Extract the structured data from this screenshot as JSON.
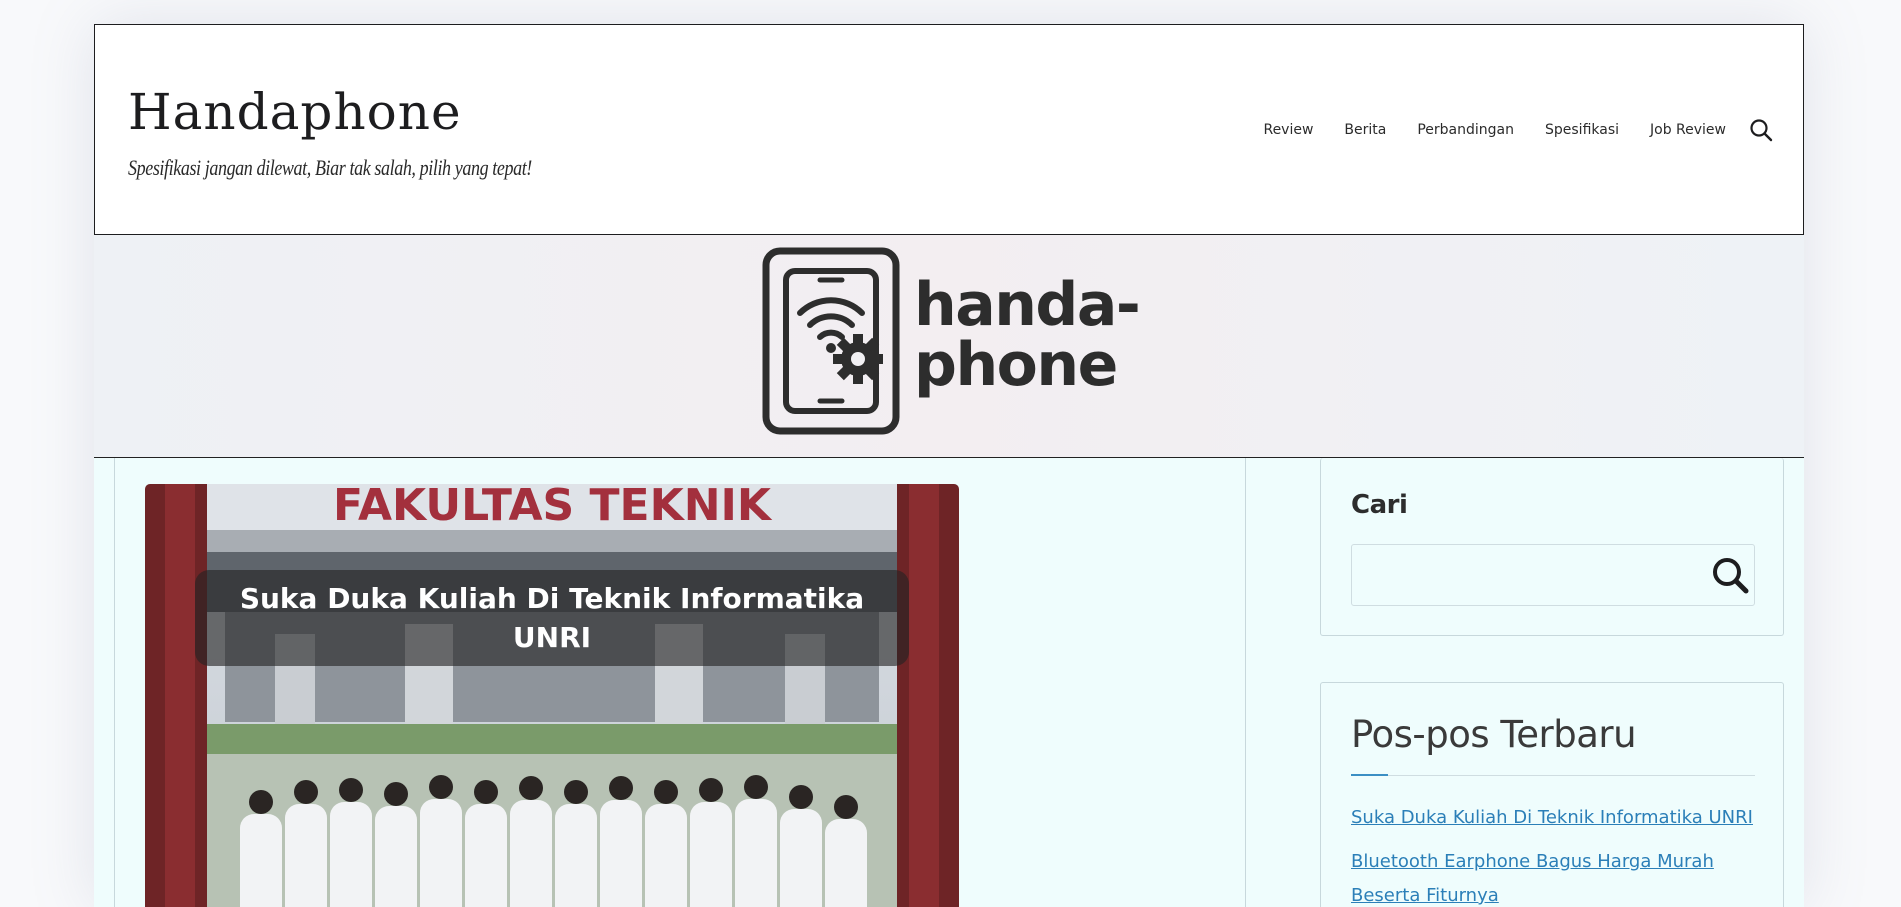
{
  "header": {
    "site_title": "Handaphone",
    "tagline": "Spesifikasi jangan dilewat, Biar tak salah, pilih yang tepat!",
    "nav": [
      {
        "label": "Review"
      },
      {
        "label": "Berita"
      },
      {
        "label": "Perbandingan"
      },
      {
        "label": "Spesifikasi"
      },
      {
        "label": "Job Review"
      }
    ],
    "search_icon": "search-icon"
  },
  "banner": {
    "logo_line1": "handa-",
    "logo_line2": "phone",
    "logo_icon": "smartphone-wifi-gear-icon"
  },
  "featured_post": {
    "image_sign_text": "FAKULTAS TEKNIK",
    "overlay_title": "Suka Duka Kuliah Di Teknik Informatika UNRI"
  },
  "sidebar": {
    "search": {
      "title": "Cari",
      "value": "",
      "button_icon": "search-icon"
    },
    "recent": {
      "title": "Pos-pos Terbaru",
      "items": [
        {
          "label": "Suka Duka Kuliah Di Teknik Informatika UNRI"
        },
        {
          "label": "Bluetooth Earphone Bagus Harga Murah Beserta Fiturnya"
        }
      ]
    }
  },
  "colors": {
    "link": "#2b7fb8",
    "content_bg": "#effdfd",
    "border": "#1d1d1f",
    "accent": "#3b8fc4"
  }
}
